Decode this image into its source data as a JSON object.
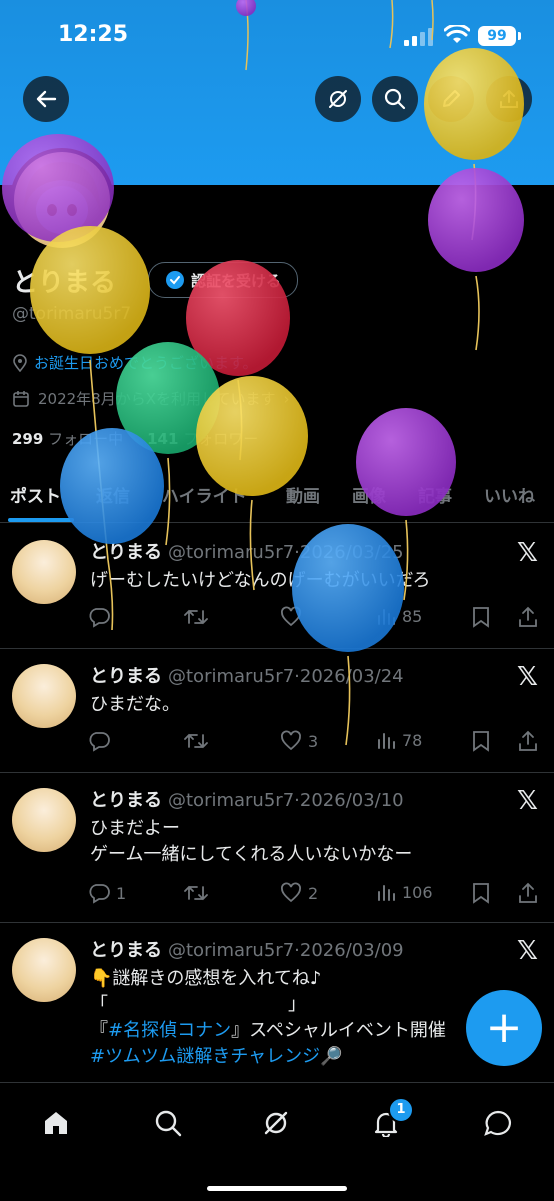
{
  "status": {
    "time": "12:25",
    "battery": "99"
  },
  "profile": {
    "name": "とりまる",
    "verify_label": "認証を受ける",
    "handle": "@torimaru5r7",
    "bio": "お誕生日おめでとうございます。",
    "joined": "2022年8月からXを利用しています",
    "following_count": "299",
    "following_label": "フォロー中",
    "followers_count": "141",
    "followers_label": "フォロワー"
  },
  "tabs": [
    "ポスト",
    "返信",
    "ハイライト",
    "動画",
    "画像",
    "記事",
    "いいね"
  ],
  "tweets": [
    {
      "name": "とりまる",
      "handle": "@torimaru5r7",
      "date": "2026/03/25",
      "line1": "げーむしたいけどなんのげーむがいいだろ",
      "replies": "",
      "likes": "",
      "views": "85"
    },
    {
      "name": "とりまる",
      "handle": "@torimaru5r7",
      "date": "2026/03/24",
      "line1": "ひまだな。",
      "replies": "",
      "likes": "3",
      "views": "78"
    },
    {
      "name": "とりまる",
      "handle": "@torimaru5r7",
      "date": "2026/03/10",
      "line1": "ひまだよー",
      "line2": "ゲーム一緒にしてくれる人いないかなー",
      "replies": "1",
      "likes": "2",
      "views": "106"
    },
    {
      "name": "とりまる",
      "handle": "@torimaru5r7",
      "date": "2026/03/09",
      "line1": "👇謎解きの感想を入れてね♪",
      "line2": "「　　　　　　　　　　」",
      "line3_prefix": "『",
      "line3_link": "#名探偵コナン",
      "line3_suffix": "』スペシャルイベント開催",
      "line4_link": "#ツムツム謎解きチャレンジ",
      "line4_suffix": "🔎"
    }
  ],
  "notification_count": "1",
  "colors": {
    "accent": "#1d9bf0",
    "header": "#1d9bf0",
    "background": "#000000"
  },
  "icons": [
    "back-arrow-icon",
    "grok-icon",
    "search-icon",
    "pencil-icon",
    "share-icon",
    "home-icon",
    "bell-icon",
    "message-icon",
    "x-logo-icon"
  ]
}
